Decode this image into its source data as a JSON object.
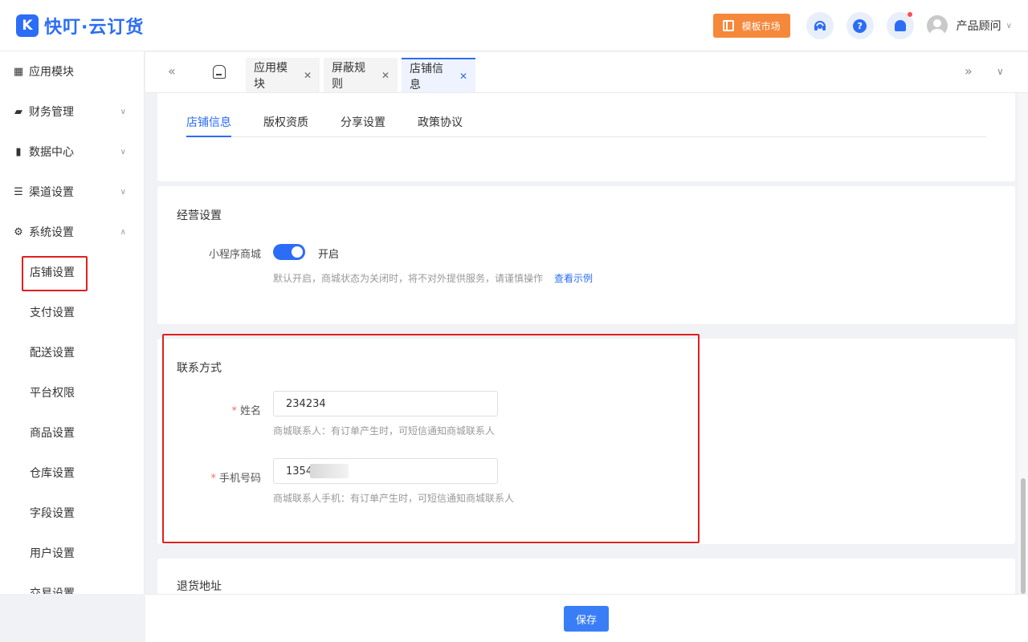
{
  "header": {
    "logo_mark": "K",
    "logo_text": "快叮·云订货",
    "market_label": "模板市场",
    "help_glyph": "?",
    "username": "产品顾问",
    "icons": [
      "headset-icon",
      "help-icon",
      "bell-icon",
      "avatar-icon"
    ]
  },
  "sidebar": {
    "items": [
      {
        "label": "应用模块",
        "icon": "grid-icon"
      },
      {
        "label": "财务管理",
        "icon": "wallet-icon"
      },
      {
        "label": "数据中心",
        "icon": "bar-chart-icon"
      },
      {
        "label": "渠道设置",
        "icon": "list-icon"
      },
      {
        "label": "系统设置",
        "icon": "gear-icon"
      }
    ],
    "sub_items": [
      "店铺设置",
      "支付设置",
      "配送设置",
      "平台权限",
      "商品设置",
      "仓库设置",
      "字段设置",
      "用户设置",
      "交易设置"
    ]
  },
  "tabs": [
    {
      "label": "应用模块"
    },
    {
      "label": "屏蔽规则"
    },
    {
      "label": "店铺信息"
    }
  ],
  "subtabs": [
    "店铺信息",
    "版权资质",
    "分享设置",
    "政策协议"
  ],
  "business": {
    "title": "经营设置",
    "mini_mall_label": "小程序商城",
    "toggle_state": "开启",
    "hint": "默认开启，商城状态为关闭时，将不对外提供服务，请谨慎操作",
    "example_link": "查看示例"
  },
  "contact": {
    "title": "联系方式",
    "name_label": "姓名",
    "name_value": "234234",
    "name_hint": "商城联系人：有订单产生时，可短信通知商城联系人",
    "phone_label": "手机号码",
    "phone_value": "1354",
    "phone_hint": "商城联系人手机：有订单产生时，可短信通知商城联系人"
  },
  "return_address": {
    "title": "退货地址"
  },
  "footer": {
    "save_label": "保存"
  },
  "colors": {
    "primary": "#2b6df6",
    "market": "#f5883b",
    "highlight_red": "#e02020",
    "required": "#f56c6c"
  }
}
